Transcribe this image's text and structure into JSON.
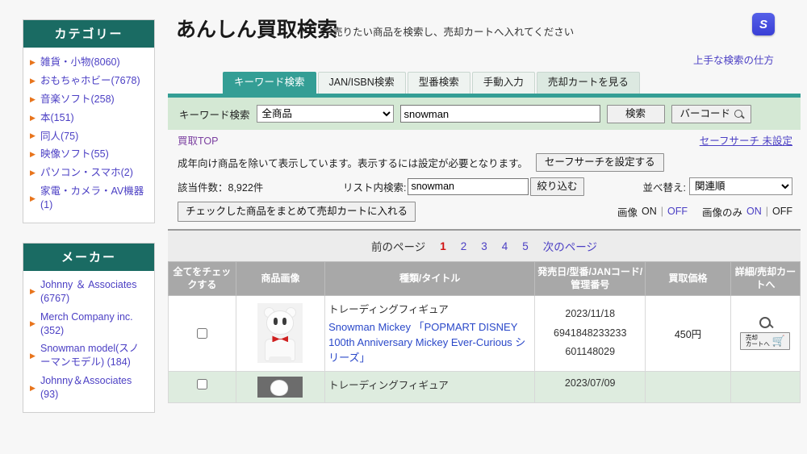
{
  "sidebar": {
    "category": {
      "title": "カテゴリー",
      "items": [
        {
          "label": "雑貨・小物(8060)"
        },
        {
          "label": "おもちゃホビー(7678)"
        },
        {
          "label": "音楽ソフト(258)"
        },
        {
          "label": "本(151)"
        },
        {
          "label": "同人(75)"
        },
        {
          "label": "映像ソフト(55)"
        },
        {
          "label": "パソコン・スマホ(2)"
        },
        {
          "label": "家電・カメラ・AV機器(1)"
        }
      ]
    },
    "maker": {
      "title": "メーカー",
      "items": [
        {
          "label": "Johnny ＆ Associates (6767)"
        },
        {
          "label": "Merch Company inc. (352)"
        },
        {
          "label": "Snowman model(スノーマンモデル) (184)"
        },
        {
          "label": "Johnny＆Associates (93)"
        }
      ]
    }
  },
  "header": {
    "title": "あんしん買取検索",
    "subtitle": "売りたい商品を検索し、売却カートへ入れてください",
    "logo_text": "S",
    "help_link": "上手な検索の仕方"
  },
  "tabs": [
    {
      "label": "キーワード検索",
      "active": true
    },
    {
      "label": "JAN/ISBN検索",
      "active": false
    },
    {
      "label": "型番検索",
      "active": false
    },
    {
      "label": "手動入力",
      "active": false
    },
    {
      "label": "売却カートを見る",
      "active": false,
      "cart": true
    }
  ],
  "searchbar": {
    "label": "キーワード検索",
    "category_selected": "全商品",
    "category_options": [
      "全商品"
    ],
    "keyword_value": "snowman",
    "keyword_placeholder": "",
    "search_button": "検索",
    "barcode_button": "バーコード",
    "barcode_icon": "search-icon"
  },
  "breadcrumb": {
    "label": "買取TOP",
    "safesearch_status": "セーフサーチ 未設定"
  },
  "notice": {
    "text": "成年向け商品を除いて表示しています。表示するには設定が必要となります。",
    "button": "セーフサーチを設定する"
  },
  "filters": {
    "count_text": "該当件数：8,922件",
    "inlist_label": "リスト内検索:",
    "inlist_value": "snowman",
    "narrow_button": "絞り込む",
    "sort_label": "並べ替え:",
    "sort_selected": "関連順",
    "sort_options": [
      "関連順"
    ]
  },
  "bulk": {
    "button": "チェックした商品をまとめて売却カートに入れる",
    "image_label": "画像",
    "image_on": "ON",
    "image_off": "OFF",
    "imageonly_label": "画像のみ",
    "imageonly_on": "ON",
    "imageonly_off": "OFF",
    "separator": "|"
  },
  "pagination": {
    "prev": "前のページ",
    "next": "次のページ",
    "pages": [
      "1",
      "2",
      "3",
      "4",
      "5"
    ],
    "current": "1"
  },
  "table": {
    "headers": [
      "全てをチェックする",
      "商品画像",
      "種類/タイトル",
      "発売日/型番/JANコード/管理番号",
      "買取価格",
      "詳細/売却カートへ"
    ],
    "rows": [
      {
        "checked": false,
        "thumb_alt": "snowman-mickey-figure",
        "kind": "トレーディングフィギュア",
        "title": "Snowman Mickey 「POPMART DISNEY 100th Anniversary Mickey Ever-Curious シリーズ」",
        "release_date": "2023/11/18",
        "jan": "6941848233233",
        "mgmt": "601148029",
        "price": "450円",
        "detail_icon": "search-icon",
        "cart_button_line1": "売却",
        "cart_button_line2": "カートへ",
        "cart_icon": "shopping-cart-icon"
      },
      {
        "kind": "トレーディングフィギュア",
        "release_date": "2023/07/09"
      }
    ]
  },
  "colors": {
    "teal_dark": "#1a6b63",
    "teal_accent": "#349e95",
    "search_bg": "#d4e8d4",
    "link_blue": "#4b3fc4",
    "title_blue": "#2b49c9",
    "current_page_red": "#d01010",
    "bullet_orange": "#e8741c",
    "row_alt_green": "#deecdf",
    "header_gray": "#a8a8a8"
  }
}
